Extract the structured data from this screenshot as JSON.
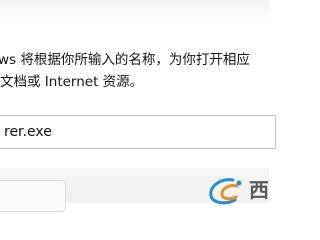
{
  "dialog": {
    "description_line1": "ws 将根据你所输入的名称，为你打开相应",
    "description_line2": "文档或 Internet 资源。"
  },
  "open_field": {
    "value": "rer.exe"
  },
  "watermark": {
    "char": "西"
  },
  "colors": {
    "watermark_blue": "#1f8fd6",
    "watermark_orange": "#f08c1e"
  }
}
